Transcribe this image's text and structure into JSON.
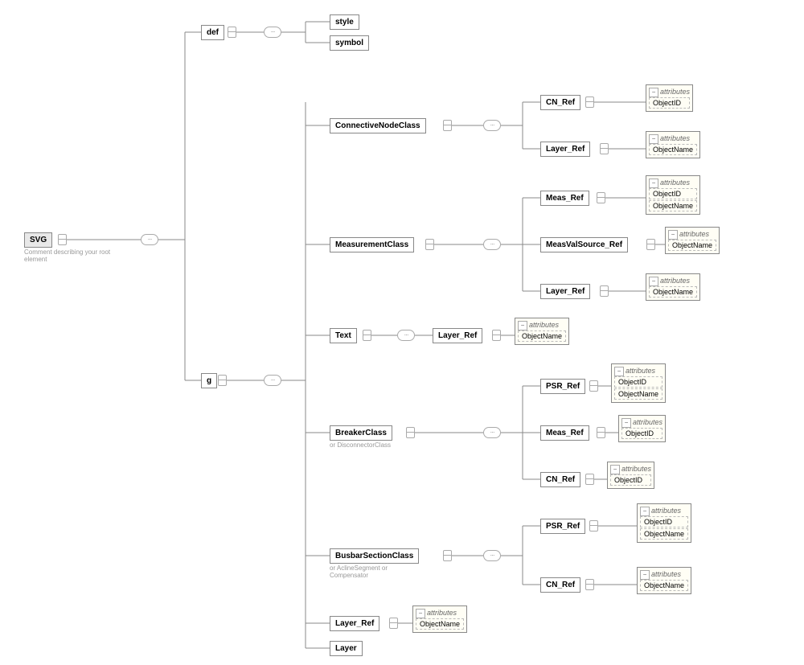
{
  "root": {
    "label": "SVG",
    "comment": "Comment describing your root element"
  },
  "def": {
    "label": "def",
    "children": [
      "style",
      "symbol"
    ]
  },
  "g": {
    "label": "g",
    "ConnectiveNodeClass": {
      "label": "ConnectiveNodeClass",
      "CN_Ref": {
        "label": "CN_Ref",
        "attrs_title": "attributes",
        "attrs": [
          "ObjectID"
        ]
      },
      "Layer_Ref": {
        "label": "Layer_Ref",
        "attrs_title": "attributes",
        "attrs": [
          "ObjectName"
        ]
      }
    },
    "MeasurementClass": {
      "label": "MeasurementClass",
      "Meas_Ref": {
        "label": "Meas_Ref",
        "attrs_title": "attributes",
        "attrs": [
          "ObjectID",
          "ObjectName"
        ]
      },
      "MeasValSource_Ref": {
        "label": "MeasValSource_Ref",
        "attrs_title": "attributes",
        "attrs": [
          "ObjectName"
        ]
      },
      "Layer_Ref": {
        "label": "Layer_Ref",
        "attrs_title": "attributes",
        "attrs": [
          "ObjectName"
        ]
      }
    },
    "Text": {
      "label": "Text",
      "Layer_Ref": {
        "label": "Layer_Ref",
        "attrs_title": "attributes",
        "attrs": [
          "ObjectName"
        ]
      }
    },
    "BreakerClass": {
      "label": "BreakerClass",
      "comment": "or DisconnectorClass",
      "PSR_Ref": {
        "label": "PSR_Ref",
        "attrs_title": "attributes",
        "attrs": [
          "ObjectID",
          "ObjectName"
        ]
      },
      "Meas_Ref": {
        "label": "Meas_Ref",
        "attrs_title": "attributes",
        "attrs": [
          "ObjectID"
        ]
      },
      "CN_Ref": {
        "label": "CN_Ref",
        "attrs_title": "attributes",
        "attrs": [
          "ObjectID"
        ]
      }
    },
    "BusbarSectionClass": {
      "label": "BusbarSectionClass",
      "comment": "or AclineSegment or Compensator",
      "PSR_Ref": {
        "label": "PSR_Ref",
        "attrs_title": "attributes",
        "attrs": [
          "ObjectID",
          "ObjectName"
        ]
      },
      "CN_Ref": {
        "label": "CN_Ref",
        "attrs_title": "attributes",
        "attrs": [
          "ObjectName"
        ]
      }
    },
    "Layer_Ref": {
      "label": "Layer_Ref",
      "attrs_title": "attributes",
      "attrs": [
        "ObjectName"
      ]
    },
    "Layer": {
      "label": "Layer"
    }
  },
  "connector_glyph": "···"
}
